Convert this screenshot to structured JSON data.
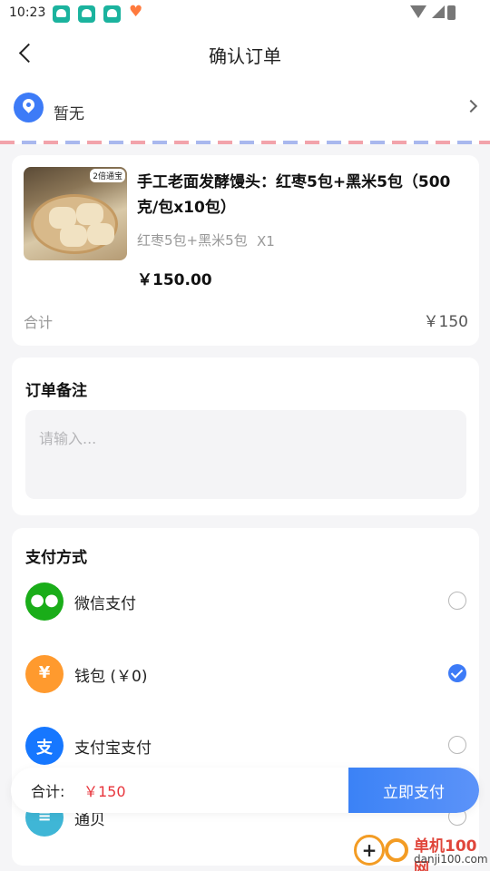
{
  "status_bar": {
    "time": "10:23"
  },
  "header": {
    "title": "确认订单"
  },
  "address": {
    "text": "暂无"
  },
  "order": {
    "product_name": "手工老面发酵馒头：红枣5包+黑米5包（500克/包x10包）",
    "image_tag": "2倍通宝",
    "spec": "红枣5包+黑米5包",
    "quantity": "X1",
    "price": "￥150.00",
    "subtotal_label": "合计",
    "subtotal_value": "￥150"
  },
  "remark": {
    "title": "订单备注",
    "placeholder": "请输入..."
  },
  "payment": {
    "title": "支付方式",
    "methods": [
      {
        "label": "微信支付",
        "icon": "wechat-icon",
        "color": "#1aad19",
        "selected": false
      },
      {
        "label": "钱包 (￥0)",
        "icon": "wallet-icon",
        "color": "#ff9a2e",
        "selected": true
      },
      {
        "label": "支付宝支付",
        "icon": "alipay-icon",
        "color": "#1677ff",
        "selected": false
      },
      {
        "label": "通贝",
        "icon": "coin-stack-icon",
        "color": "#3fb6d6",
        "selected": false
      }
    ]
  },
  "footer": {
    "total_label": "合计:",
    "total_value": "￥150",
    "pay_button": "立即支付"
  },
  "watermark": {
    "title": "单机100网",
    "url": "danji100.com"
  },
  "colors": {
    "accent": "#3d7bf7",
    "price_red": "#e8343b"
  }
}
